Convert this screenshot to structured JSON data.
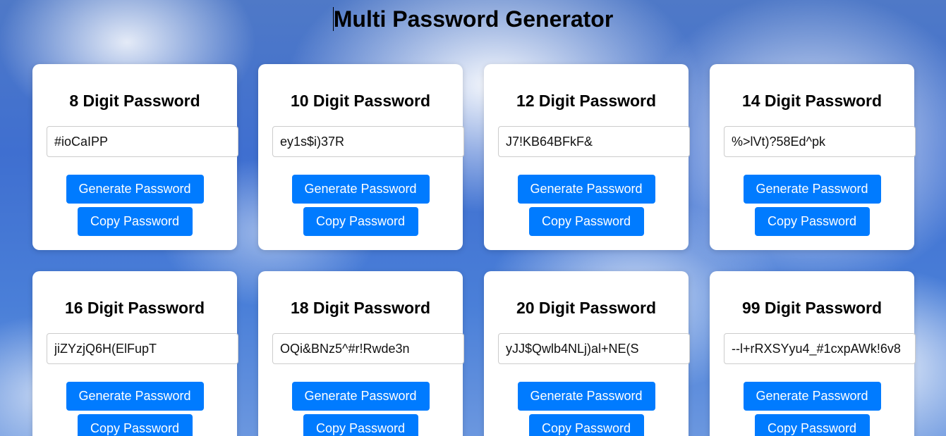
{
  "page": {
    "title": "Multi Password Generator"
  },
  "colors": {
    "button_bg": "#007bff",
    "card_bg": "#ffffff"
  },
  "cards": [
    {
      "title": "8 Digit Password",
      "value": "#ioCaIPP",
      "generate_label": "Generate Password",
      "copy_label": "Copy Password"
    },
    {
      "title": "10 Digit Password",
      "value": "ey1s$i)37R",
      "generate_label": "Generate Password",
      "copy_label": "Copy Password"
    },
    {
      "title": "12 Digit Password",
      "value": "J7!KB64BFkF&",
      "generate_label": "Generate Password",
      "copy_label": "Copy Password"
    },
    {
      "title": "14 Digit Password",
      "value": "%>lVt)?58Ed^pk",
      "generate_label": "Generate Password",
      "copy_label": "Copy Password"
    },
    {
      "title": "16 Digit Password",
      "value": "jiZYzjQ6H(ElFupT",
      "generate_label": "Generate Password",
      "copy_label": "Copy Password"
    },
    {
      "title": "18 Digit Password",
      "value": "OQi&BNz5^#r!Rwde3n",
      "generate_label": "Generate Password",
      "copy_label": "Copy Password"
    },
    {
      "title": "20 Digit Password",
      "value": "yJJ$Qwlb4NLj)al+NE(S",
      "generate_label": "Generate Password",
      "copy_label": "Copy Password"
    },
    {
      "title": "99 Digit Password",
      "value": "--l+rRXSYyu4_#1cxpAWk!6v8",
      "generate_label": "Generate Password",
      "copy_label": "Copy Password"
    }
  ]
}
